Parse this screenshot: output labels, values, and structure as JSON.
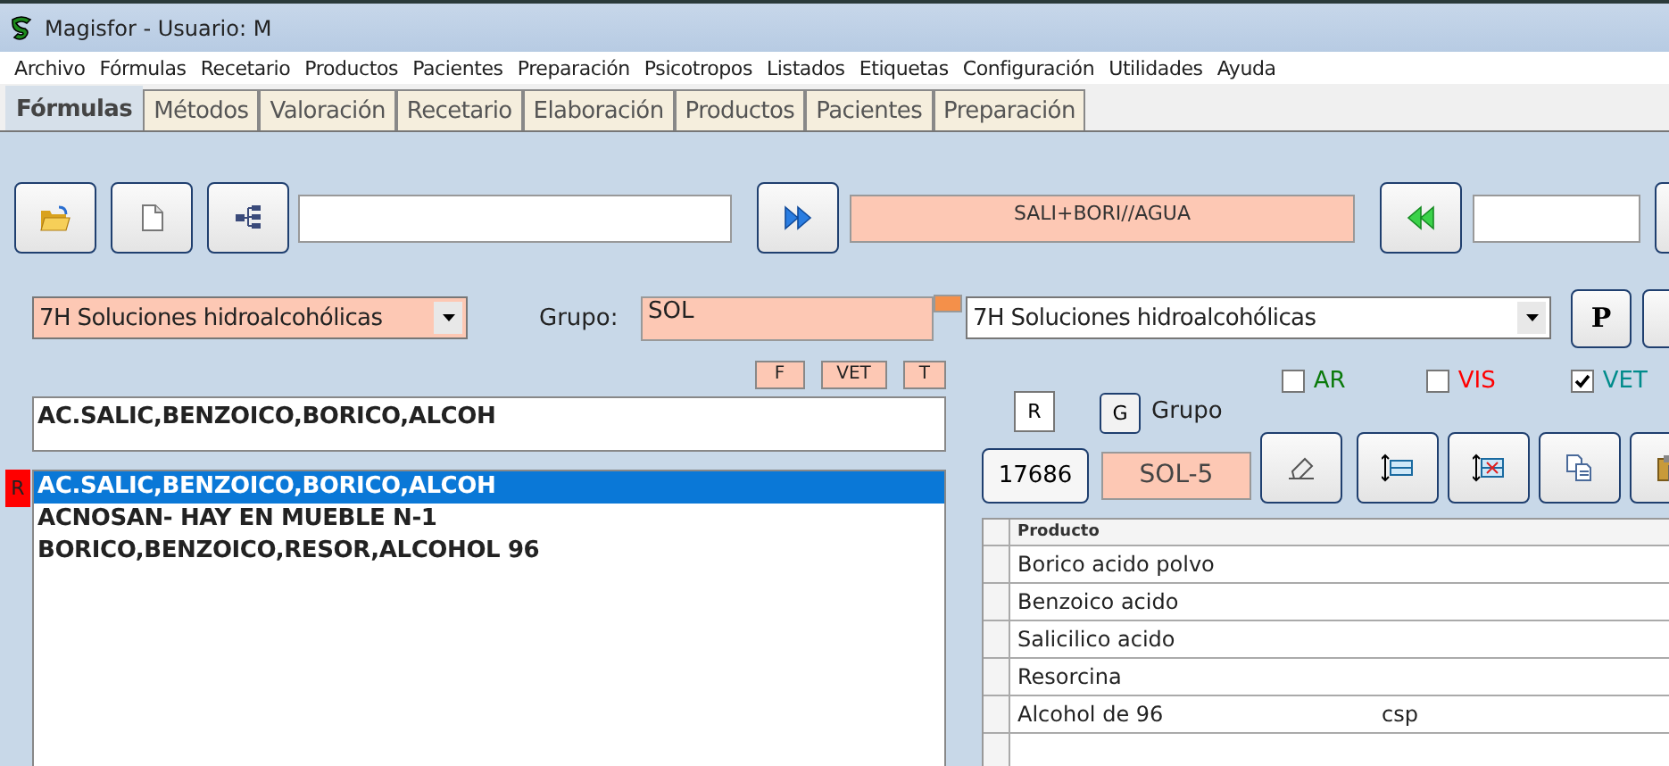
{
  "window": {
    "title": "Magisfor - Usuario: M"
  },
  "menu": [
    "Archivo",
    "Fórmulas",
    "Recetario",
    "Productos",
    "Pacientes",
    "Preparación",
    "Psicotropos",
    "Listados",
    "Etiquetas",
    "Configuración",
    "Utilidades",
    "Ayuda"
  ],
  "tabs": [
    {
      "label": "Fórmulas",
      "selected": true
    },
    {
      "label": "Métodos",
      "selected": false
    },
    {
      "label": "Valoración",
      "selected": false
    },
    {
      "label": "Recetario",
      "selected": false
    },
    {
      "label": "Elaboración",
      "selected": false
    },
    {
      "label": "Productos",
      "selected": false
    },
    {
      "label": "Pacientes",
      "selected": false
    },
    {
      "label": "Preparación",
      "selected": false
    }
  ],
  "short_name_field": {
    "value": "SALI+BORI//AGUA"
  },
  "category_select": {
    "value": "7H Soluciones hidroalcohólicas"
  },
  "group": {
    "label": "Grupo:",
    "value": "SOL"
  },
  "group_select": {
    "value": "7H Soluciones hidroalcohólicas"
  },
  "p_button": "P",
  "flag_chips": [
    "F",
    "VET",
    "T"
  ],
  "name_field": {
    "value": "AC.SALIC,BENZOICO,BORICO,ALCOH"
  },
  "row_marker": "R",
  "formula_list": [
    {
      "text": "AC.SALIC,BENZOICO,BORICO,ALCOH",
      "selected": true
    },
    {
      "text": "ACNOSAN- HAY EN MUEBLE N-1",
      "selected": false
    },
    {
      "text": "BORICO,BENZOICO,RESOR,ALCOHOL 96",
      "selected": false
    }
  ],
  "r_button": "R",
  "g_button": "G",
  "grupo_label": "Grupo",
  "checkboxes": [
    {
      "label": "AR",
      "checked": false,
      "color": "#0b7a0b"
    },
    {
      "label": "VIS",
      "checked": false,
      "color": "#ff0000"
    },
    {
      "label": "VET",
      "checked": true,
      "color": "#008b8b"
    }
  ],
  "code_button": "17686",
  "code_field": "SOL-5",
  "products": {
    "columns": [
      "Producto"
    ],
    "rows": [
      {
        "product": "Borico acido polvo"
      },
      {
        "product": "Benzoico acido"
      },
      {
        "product": "Salicilico acido"
      },
      {
        "product": "Resorcina"
      },
      {
        "product": "Alcohol de 96",
        "column_2": "csp"
      }
    ]
  }
}
